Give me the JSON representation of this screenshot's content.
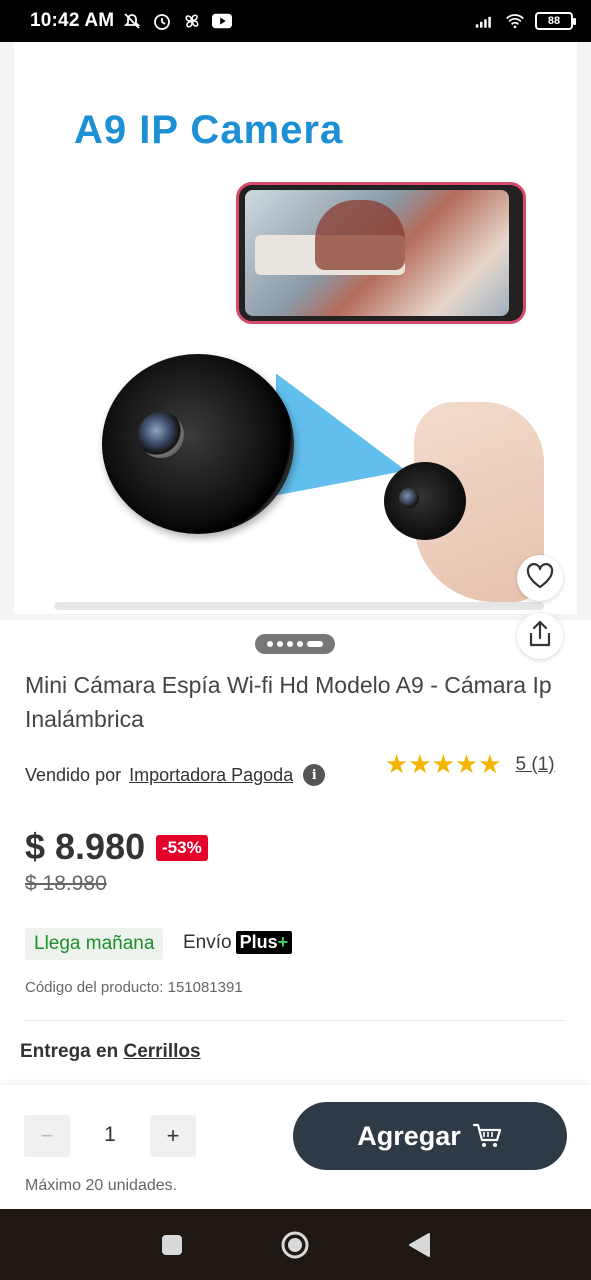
{
  "status_bar": {
    "time": "10:42 AM",
    "battery": "88"
  },
  "product_image": {
    "title_text": "A9 IP Camera"
  },
  "product": {
    "title": "Mini Cámara Espía Wi-fi Hd Modelo A9 - Cámara Ip Inalámbrica",
    "seller_prefix": "Vendido por",
    "seller_name": "Importadora Pagoda",
    "rating_value": 5,
    "rating_stars": "★★★★★",
    "rating_label": "5 (1)",
    "price": "$ 8.980",
    "discount": "-53%",
    "old_price": "$ 18.980",
    "arrival": "Llega mañana",
    "shipping_label": "Envío",
    "shipping_badge": "Plus",
    "shipping_badge_plus": "+",
    "product_code": "Código del producto: 151081391",
    "delivery_prefix": "Entrega en",
    "delivery_location": "Cerrillos"
  },
  "cart_panel": {
    "minus": "−",
    "quantity": "1",
    "plus": "+",
    "add_label": "Agregar",
    "max_units": "Máximo 20 unidades."
  },
  "colors": {
    "discount_bg": "#e4002b",
    "arrival_text": "#1b8f2a",
    "add_button": "#2e3a46",
    "star": "#f4b400",
    "title_blue": "#1d8fd4"
  },
  "carousel": {
    "count": 5,
    "active_index": 4
  }
}
